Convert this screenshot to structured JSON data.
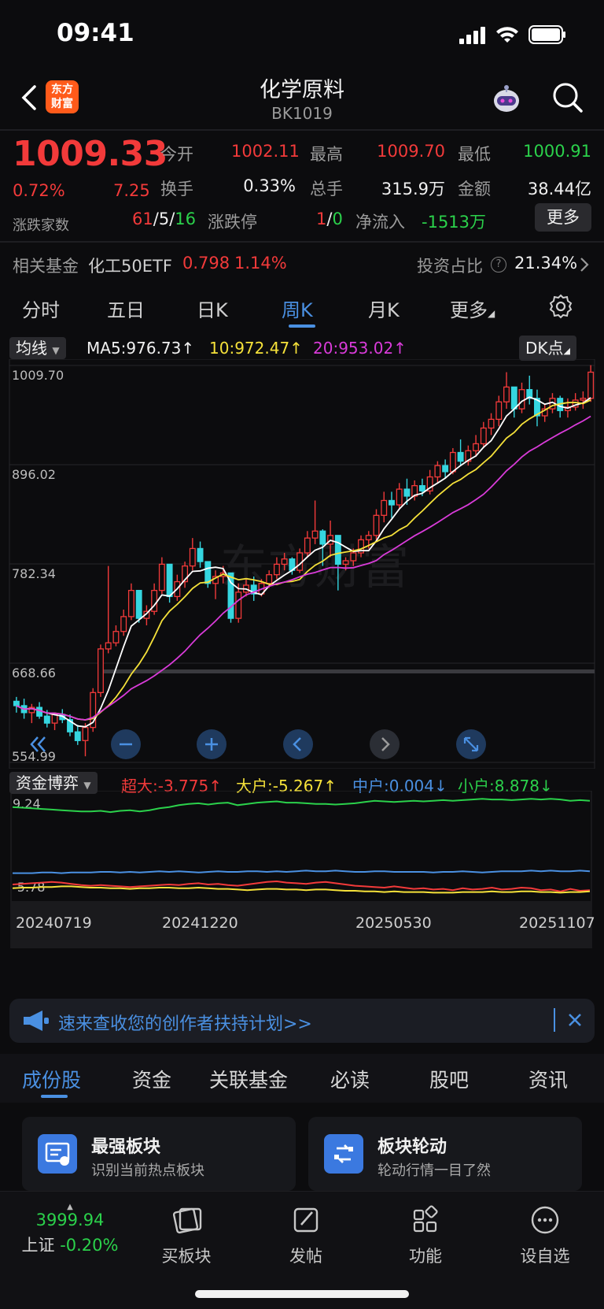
{
  "status_bar": {
    "time": "09:41"
  },
  "header": {
    "logo_text_1": "东方",
    "logo_text_2": "财富",
    "title": "化学原料",
    "code": "BK1019"
  },
  "quote": {
    "price": "1009.33",
    "change_pct": "0.72%",
    "change_abs": "7.25",
    "rows": [
      [
        {
          "label": "今开",
          "value": "1002.11",
          "color": "red"
        },
        {
          "label": "最高",
          "value": "1009.70",
          "color": "red"
        },
        {
          "label": "最低",
          "value": "1000.91",
          "color": "green"
        }
      ],
      [
        {
          "label": "换手",
          "value": "0.33%",
          "color": "white"
        },
        {
          "label": "总手",
          "value": "315.9万",
          "color": "white"
        },
        {
          "label": "金额",
          "value": "38.44亿",
          "color": "white"
        }
      ]
    ],
    "breadth_label": "涨跌家数",
    "breadth_up": "61",
    "breadth_flat": "5",
    "breadth_down": "16",
    "limit_label": "涨跌停",
    "limit_up": "1",
    "limit_down": "0",
    "inflow_label": "净流入",
    "inflow_value": "-1513万",
    "more_label": "更多"
  },
  "fund": {
    "label": "相关基金",
    "name": "化工50ETF",
    "price": "0.798",
    "pct": "1.14%",
    "ratio_label": "投资占比",
    "ratio_value": "21.34%"
  },
  "tabs": [
    "分时",
    "五日",
    "日K",
    "周K",
    "月K",
    "更多"
  ],
  "active_tab": "周K",
  "indicator": {
    "selector": "均线",
    "ma5": "MA5:976.73↑",
    "ma10": "10:972.47↑",
    "ma20": "20:953.02↑",
    "dk": "DK点",
    "colors": {
      "ma5": "#ffffff",
      "ma10": "#f5e13a",
      "ma20": "#d93bd9",
      "up": "#f23a3a",
      "down": "#35d6e0"
    }
  },
  "chart_data": [
    {
      "type": "candlestick",
      "title": "",
      "y_ticks": [
        "1009.70",
        "896.02",
        "782.34",
        "668.66",
        "554.99"
      ],
      "ylim": [
        554.99,
        1009.7
      ],
      "watermark": "东方财富",
      "bars": [
        [
          625,
          630,
          612,
          620
        ],
        [
          620,
          628,
          605,
          612
        ],
        [
          612,
          622,
          600,
          618
        ],
        [
          618,
          624,
          605,
          608
        ],
        [
          608,
          615,
          595,
          600
        ],
        [
          600,
          612,
          592,
          610
        ],
        [
          610,
          616,
          600,
          604
        ],
        [
          604,
          610,
          585,
          590
        ],
        [
          590,
          598,
          575,
          580
        ],
        [
          580,
          600,
          562,
          595
        ],
        [
          595,
          640,
          590,
          635
        ],
        [
          635,
          690,
          630,
          685
        ],
        [
          685,
          780,
          680,
          692
        ],
        [
          692,
          712,
          688,
          705
        ],
        [
          705,
          730,
          700,
          722
        ],
        [
          722,
          760,
          718,
          752
        ],
        [
          752,
          748,
          715,
          720
        ],
        [
          720,
          735,
          712,
          728
        ],
        [
          728,
          760,
          724,
          752
        ],
        [
          752,
          790,
          748,
          782
        ],
        [
          782,
          782,
          738,
          745
        ],
        [
          745,
          770,
          740,
          762
        ],
        [
          762,
          785,
          755,
          780
        ],
        [
          780,
          812,
          775,
          800
        ],
        [
          800,
          808,
          778,
          785
        ],
        [
          785,
          785,
          755,
          760
        ],
        [
          760,
          775,
          742,
          768
        ],
        [
          768,
          780,
          760,
          772
        ],
        [
          772,
          770,
          715,
          720
        ],
        [
          720,
          760,
          715,
          750
        ],
        [
          750,
          765,
          745,
          758
        ],
        [
          758,
          768,
          740,
          748
        ],
        [
          748,
          765,
          745,
          760
        ],
        [
          760,
          775,
          755,
          770
        ],
        [
          770,
          790,
          765,
          782
        ],
        [
          782,
          795,
          775,
          788
        ],
        [
          788,
          790,
          770,
          775
        ],
        [
          775,
          800,
          772,
          795
        ],
        [
          795,
          820,
          790,
          812
        ],
        [
          812,
          855,
          805,
          820
        ],
        [
          820,
          822,
          780,
          805
        ],
        [
          805,
          832,
          790,
          815
        ],
        [
          815,
          812,
          752,
          782
        ],
        [
          782,
          790,
          775,
          786
        ],
        [
          786,
          800,
          780,
          795
        ],
        [
          795,
          815,
          790,
          810
        ],
        [
          810,
          820,
          800,
          815
        ],
        [
          815,
          845,
          810,
          838
        ],
        [
          838,
          865,
          830,
          855
        ],
        [
          855,
          865,
          835,
          850
        ],
        [
          850,
          875,
          845,
          868
        ],
        [
          868,
          880,
          850,
          860
        ],
        [
          860,
          878,
          855,
          872
        ],
        [
          872,
          880,
          860,
          866
        ],
        [
          866,
          890,
          862,
          882
        ],
        [
          882,
          900,
          875,
          895
        ],
        [
          895,
          902,
          880,
          888
        ],
        [
          888,
          915,
          885,
          910
        ],
        [
          910,
          925,
          895,
          900
        ],
        [
          900,
          918,
          895,
          912
        ],
        [
          912,
          930,
          905,
          920
        ],
        [
          920,
          945,
          915,
          938
        ],
        [
          938,
          955,
          930,
          948
        ],
        [
          948,
          975,
          940,
          968
        ],
        [
          968,
          1002,
          960,
          985
        ],
        [
          985,
          978,
          950,
          960
        ],
        [
          960,
          990,
          955,
          982
        ],
        [
          982,
          998,
          965,
          972
        ],
        [
          972,
          982,
          940,
          952
        ],
        [
          952,
          965,
          945,
          960
        ],
        [
          960,
          978,
          955,
          972
        ],
        [
          972,
          975,
          950,
          958
        ],
        [
          958,
          972,
          950,
          962
        ],
        [
          962,
          978,
          958,
          970
        ],
        [
          970,
          980,
          960,
          972
        ],
        [
          972,
          1010,
          968,
          1002
        ]
      ]
    },
    {
      "type": "line",
      "title": "资金博弈",
      "series": [
        {
          "name": "超大:-3.775↑",
          "color": "#f23a3a",
          "values": [
            -4.4,
            -4.3,
            -4.2,
            -4.1,
            -4.0,
            -4.1,
            -4.3,
            -4.5,
            -4.6,
            -4.5,
            -4.6,
            -4.7,
            -4.8,
            -4.7,
            -4.6,
            -4.5,
            -4.4,
            -4.5,
            -4.3,
            -4.2,
            -4.4,
            -4.3,
            -4.5,
            -4.6,
            -4.4,
            -4.2,
            -4.0,
            -3.9,
            -4.1,
            -4.2,
            -4.3,
            -4.1,
            -4.0,
            -4.2,
            -4.4,
            -4.6,
            -4.7,
            -4.8,
            -4.9,
            -4.7,
            -4.9,
            -5.1,
            -5.0,
            -5.2,
            -5.1,
            -5.3,
            -5.0,
            -5.2,
            -5.1,
            -4.9,
            -5.2,
            -5.1,
            -4.9,
            -5.0,
            -5.3,
            -5.2,
            -5.5,
            -5.1,
            -5.4,
            -5.3
          ]
        },
        {
          "name": "大户:-5.267↑",
          "color": "#f5e13a",
          "values": [
            -5.0,
            -4.9,
            -4.9,
            -4.8,
            -4.8,
            -4.7,
            -4.7,
            -4.8,
            -4.9,
            -4.9,
            -5.0,
            -5.0,
            -5.1,
            -5.0,
            -5.0,
            -4.9,
            -4.9,
            -5.0,
            -5.0,
            -4.9,
            -5.0,
            -5.1,
            -5.1,
            -5.2,
            -5.3,
            -5.2,
            -5.1,
            -5.1,
            -5.2,
            -5.2,
            -5.3,
            -5.2,
            -5.2,
            -5.3,
            -5.4,
            -5.4,
            -5.5,
            -5.5,
            -5.6,
            -5.5,
            -5.6,
            -5.6,
            -5.6,
            -5.7,
            -5.7,
            -5.7,
            -5.6,
            -5.6,
            -5.6,
            -5.5,
            -5.6,
            -5.6,
            -5.5,
            -5.5,
            -5.6,
            -5.6,
            -5.7,
            -5.6,
            -5.6,
            -5.5
          ]
        },
        {
          "name": "中户:0.004↓",
          "color": "#4a90e2",
          "values": [
            -2.6,
            -2.6,
            -2.6,
            -2.5,
            -2.5,
            -2.6,
            -2.5,
            -2.5,
            -2.5,
            -2.4,
            -2.4,
            -2.5,
            -2.4,
            -2.5,
            -2.4,
            -2.3,
            -2.4,
            -2.3,
            -2.4,
            -2.5,
            -2.4,
            -2.3,
            -2.4,
            -2.4,
            -2.3,
            -2.3,
            -2.4,
            -2.3,
            -2.4,
            -2.3,
            -2.2,
            -2.3,
            -2.3,
            -2.2,
            -2.3,
            -2.4,
            -2.4,
            -2.3,
            -2.3,
            -2.4,
            -2.4,
            -2.4,
            -2.4,
            -2.5,
            -2.4,
            -2.4,
            -2.3,
            -2.4,
            -2.5,
            -2.4,
            -2.3,
            -2.3,
            -2.3,
            -2.2,
            -2.3,
            -2.2,
            -2.3,
            -2.3,
            -2.2,
            -2.3
          ]
        },
        {
          "name": "小户:8.878↓",
          "color": "#2bd14b",
          "values": [
            7.9,
            7.8,
            7.7,
            7.6,
            7.5,
            7.4,
            7.3,
            7.2,
            7.2,
            7.3,
            7.1,
            7.3,
            7.4,
            7.2,
            7.4,
            7.7,
            7.9,
            8.2,
            8.4,
            8.5,
            8.3,
            8.5,
            8.6,
            8.2,
            8.4,
            8.6,
            8.7,
            8.8,
            8.6,
            8.6,
            8.5,
            8.4,
            8.4,
            8.3,
            8.4,
            8.5,
            8.7,
            8.9,
            8.8,
            8.7,
            8.8,
            8.9,
            8.8,
            8.9,
            9.0,
            8.9,
            9.0,
            9.1,
            9.2,
            9.1,
            9.1,
            9.0,
            9.1,
            9.2,
            9.1,
            9.2,
            9.1,
            8.9,
            9.0,
            8.9
          ]
        }
      ],
      "y_ticks": [
        "9.24",
        "-5.78"
      ],
      "ylim": [
        -5.78,
        9.24
      ],
      "x_labels": [
        "20240719",
        "20241220",
        "20250530",
        "20251107"
      ]
    }
  ],
  "banner": {
    "text": "速来查收您的创作者扶持计划>>"
  },
  "bottom_tabs": [
    "成份股",
    "资金",
    "关联基金",
    "必读",
    "股吧",
    "资讯"
  ],
  "active_bottom_tab": "成份股",
  "cards": [
    {
      "title": "最强板块",
      "sub": "识别当前热点板块"
    },
    {
      "title": "板块轮动",
      "sub": "轮动行情一目了然"
    }
  ],
  "bottom_nav": {
    "index_value": "3999.94",
    "index_name": "上证",
    "index_pct": "-0.20%",
    "items": [
      "买板块",
      "发帖",
      "功能",
      "设自选"
    ]
  }
}
